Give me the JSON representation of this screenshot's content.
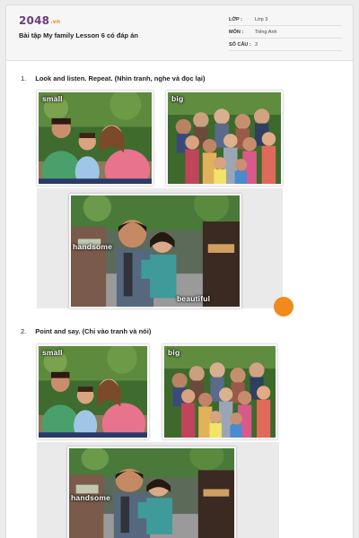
{
  "header": {
    "logo_text": "2048",
    "logo_suffix": ".vn",
    "title": "Bài tập My family Lesson 6 có đáp án",
    "meta": [
      {
        "label": "LỚP :",
        "value": "Lớp 3"
      },
      {
        "label": "MÔN :",
        "value": "Tiếng Anh"
      },
      {
        "label": "SỐ CÂU :",
        "value": "3"
      }
    ]
  },
  "sections": [
    {
      "number": "1.",
      "title": "Look and listen. Repeat. (Nhìn tranh, nghe và đọc lại)",
      "captions": {
        "small": "small",
        "big": "big",
        "handsome": "handsome",
        "beautiful": "beautiful"
      }
    },
    {
      "number": "2.",
      "title": "Point and say. (Chỉ vào tranh và nói)",
      "captions": {
        "small": "small",
        "big": "big",
        "handsome": "handsome"
      }
    }
  ],
  "colors": {
    "logo": "#6a3d7a",
    "logo_suffix": "#e28a1e",
    "accent_orange": "#f08a1c"
  }
}
